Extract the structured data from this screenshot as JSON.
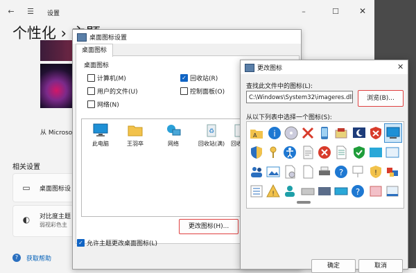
{
  "settings": {
    "window_title": "设置",
    "page_title": "个性化 › 主题",
    "from_microsoft": "从 Microso",
    "related_title": "相关设置",
    "card1_label": "桌面图标设",
    "card2_label": "对比度主题",
    "card2_sub": "弱视彩色主",
    "help_link": "获取帮助"
  },
  "dialog1": {
    "title": "桌面图标设置",
    "tab": "桌面图标",
    "group_label": "桌面图标",
    "checkboxes": [
      {
        "label": "计算机(M)",
        "checked": false
      },
      {
        "label": "回收站(R)",
        "checked": true
      },
      {
        "label": "用户的文件(U)",
        "checked": false
      },
      {
        "label": "控制面板(O)",
        "checked": false
      },
      {
        "label": "网络(N)",
        "checked": false
      }
    ],
    "icons": [
      {
        "label": "此电脑",
        "icon": "monitor-icon"
      },
      {
        "label": "王羽卒",
        "icon": "folder-icon"
      },
      {
        "label": "网络",
        "icon": "network-icon"
      },
      {
        "label": "回收站(满)",
        "icon": "recycle-bin-full-icon"
      },
      {
        "label": "回收站",
        "icon": "recycle-bin-empty-icon"
      }
    ],
    "change_icon_button": "更改图标(H)...",
    "allow_themes_label": "允许主题更改桌面图标(L)",
    "allow_themes_checked": true
  },
  "dialog2": {
    "title": "更改图标",
    "find_label": "查找此文件中的图标(L):",
    "path_value": "C:\\Windows\\System32\\imageres.dll",
    "browse_button": "浏览(B)...",
    "select_label": "从以下列表中选择一个图标(S):",
    "ok_button": "确定",
    "cancel_button": "取消"
  }
}
